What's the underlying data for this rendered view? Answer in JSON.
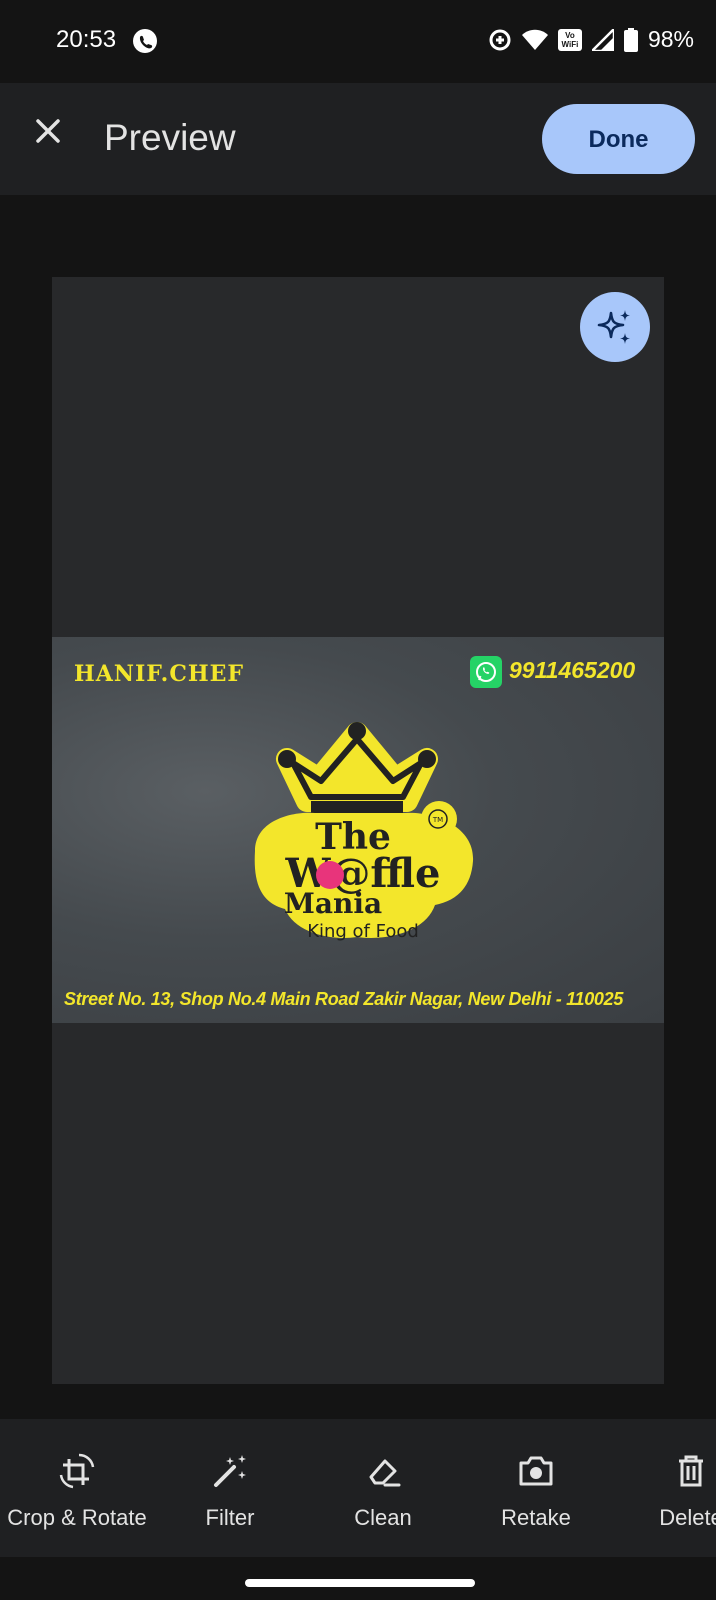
{
  "status_bar": {
    "time": "20:53",
    "battery_percent": "98%",
    "wifi_calling_label": "Vo WiFi",
    "icons": [
      "whatsapp-call-icon",
      "data-saver-icon",
      "wifi-icon",
      "vowifi-icon",
      "cell-signal-icon",
      "battery-icon"
    ]
  },
  "app_bar": {
    "title": "Preview",
    "done_label": "Done",
    "close_icon": "close-icon",
    "done_color": "#a8c7fa"
  },
  "preview": {
    "enhance_icon": "sparkle-icon",
    "card": {
      "name": "HANIF.CHEF",
      "phone": "9911465200",
      "logo_the": "The",
      "logo_waffle": "W@ffle",
      "logo_mania": "Mania",
      "logo_tm": "TM",
      "logo_tagline": "King of Food",
      "address": "Street No. 13, Shop No.4 Main Road Zakir Nagar, New Delhi - 110025",
      "accent_color": "#f3e62b"
    }
  },
  "toolbar": {
    "crop_rotate": "Crop & Rotate",
    "filter": "Filter",
    "clean": "Clean",
    "retake": "Retake",
    "delete": "Delete"
  }
}
